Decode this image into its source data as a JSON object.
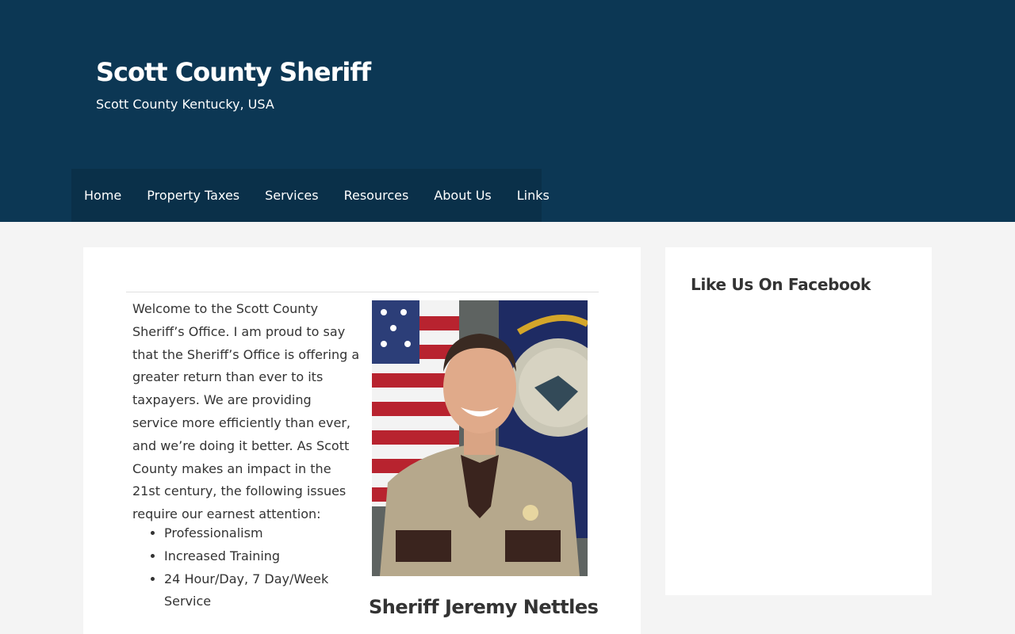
{
  "header": {
    "title": "Scott County Sheriff",
    "tagline": "Scott County Kentucky, USA"
  },
  "nav": {
    "items": [
      "Home",
      "Property Taxes",
      "Services",
      "Resources",
      "About Us",
      "Links"
    ]
  },
  "main": {
    "intro": "Welcome to the Scott County Sheriff’s Office.  I am proud to say that the Sheriff’s Office is offering a greater return than ever to its taxpayers.  We are providing service more efficiently than ever, and we’re doing it better.  As Scott County makes an impact in the 21st century, the following issues require our earnest attention:",
    "bullets": [
      "Professionalism",
      "Increased Training",
      "24 Hour/Day, 7 Day/Week Service"
    ],
    "photo_caption": "Sheriff Jeremy Nettles"
  },
  "sidebar": {
    "widget_title": "Like Us On Facebook"
  },
  "colors": {
    "header_bg": "#0c3754",
    "nav_bg": "#0a3049",
    "page_bg": "#f4f4f4"
  }
}
